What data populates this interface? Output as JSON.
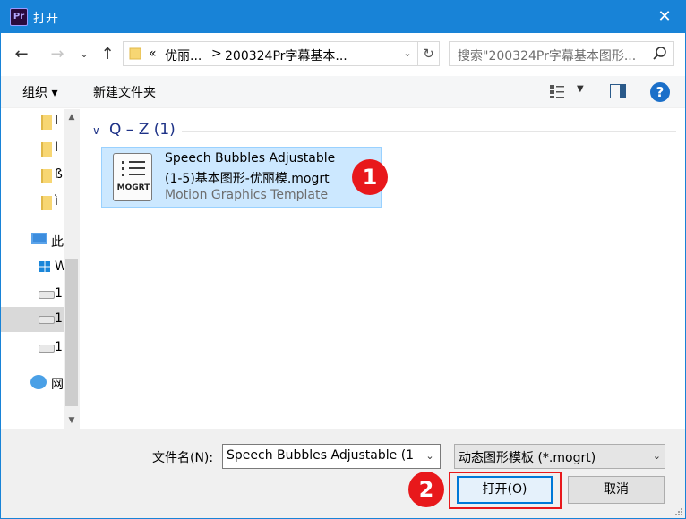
{
  "window": {
    "title": "打开",
    "app_icon_text": "Pr",
    "close_icon": "close-icon"
  },
  "navbar": {
    "back_icon": "arrow-left-icon",
    "forward_icon": "arrow-right-icon",
    "recent_icon": "chevron-down-icon",
    "up_icon": "arrow-up-icon",
    "address": {
      "overflow": "«",
      "segment1": "优丽...",
      "separator": ">",
      "segment2": "200324Pr字幕基本..."
    },
    "refresh_icon": "refresh-icon",
    "search_placeholder": "搜索\"200324Pr字幕基本图形..."
  },
  "toolbar": {
    "organize_label": "组织 ▾",
    "new_folder_label": "新建文件夹",
    "help_label": "?"
  },
  "navpane": {
    "items": [
      {
        "type": "folder",
        "label": "I"
      },
      {
        "type": "folder",
        "label": "I"
      },
      {
        "type": "folder",
        "label": "ß"
      },
      {
        "type": "folder",
        "label": "ì"
      },
      {
        "type": "pc",
        "label": "此"
      },
      {
        "type": "windows",
        "label": "W"
      },
      {
        "type": "drive",
        "label": "1"
      },
      {
        "type": "drive",
        "label": "1",
        "selected": true
      },
      {
        "type": "drive",
        "label": "1"
      },
      {
        "type": "network",
        "label": "网"
      }
    ]
  },
  "content": {
    "group_label": "Q – Z (1)",
    "file": {
      "icon_label": "MOGRT",
      "name_line1": "Speech Bubbles Adjustable",
      "name_line2": "(1-5)基本图形-优丽模.mogrt",
      "type": "Motion Graphics Template"
    },
    "badge1": "1"
  },
  "bottom": {
    "filename_label": "文件名(N):",
    "filename_value": "Speech Bubbles Adjustable (1",
    "filetype_value": "动态图形模板 (*.mogrt)",
    "open_label": "打开(O)",
    "cancel_label": "取消",
    "badge2": "2"
  },
  "colors": {
    "titlebar": "#1883d7",
    "selection": "#cce8ff",
    "badge": "#e8181b",
    "group_header": "#1e3287"
  }
}
